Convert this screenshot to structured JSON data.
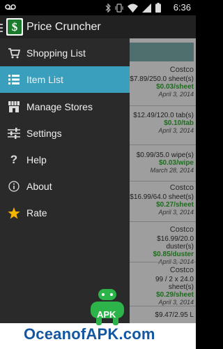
{
  "status_bar": {
    "time": "6:36"
  },
  "app": {
    "title": "Price Cruncher"
  },
  "drawer": {
    "items": [
      {
        "label": "Shopping List",
        "icon": "cart-icon",
        "selected": false
      },
      {
        "label": "Item List",
        "icon": "list-icon",
        "selected": true
      },
      {
        "label": "Manage Stores",
        "icon": "store-icon",
        "selected": false
      },
      {
        "label": "Settings",
        "icon": "sliders-icon",
        "selected": false
      },
      {
        "label": "Help",
        "icon": "question-icon",
        "selected": false
      },
      {
        "label": "About",
        "icon": "info-icon",
        "selected": false
      },
      {
        "label": "Rate",
        "icon": "star-icon",
        "selected": false
      }
    ]
  },
  "items": [
    {
      "store": "Costco",
      "detail": "$7.89/250.0 sheet(s)",
      "unit_price": "$0.03/sheet",
      "date": "April 3, 2014"
    },
    {
      "store": "",
      "detail": "$12.49/120.0 tab(s)",
      "unit_price": "$0.10/tab",
      "date": "April 3, 2014"
    },
    {
      "store": "",
      "detail": "$0.99/35.0 wipe(s)",
      "unit_price": "$0.03/wipe",
      "date": "March 28, 2014"
    },
    {
      "store": "Costco",
      "detail": "$16.99/64.0 sheet(s)",
      "unit_price": "$0.27/sheet",
      "date": "April 3, 2014"
    },
    {
      "store": "Costco",
      "detail": "$16.99/20.0 duster(s)",
      "unit_price": "$0.85/duster",
      "date": "April 3, 2014"
    },
    {
      "store": "Costco",
      "detail": "99 / 2 x 24.0 sheet(s)",
      "unit_price": "$0.29/sheet",
      "date": "April 3, 2014"
    },
    {
      "store": "",
      "detail": "$9.47/2.95 L",
      "unit_price": "",
      "date": ""
    }
  ],
  "watermark": {
    "badge": "APK",
    "text": "OceanofAPK.com"
  },
  "colors": {
    "selected": "#3a9ebd",
    "drawer_bg": "#2a2a2a",
    "price": "#1e6b1e",
    "star": "#f5b400"
  }
}
